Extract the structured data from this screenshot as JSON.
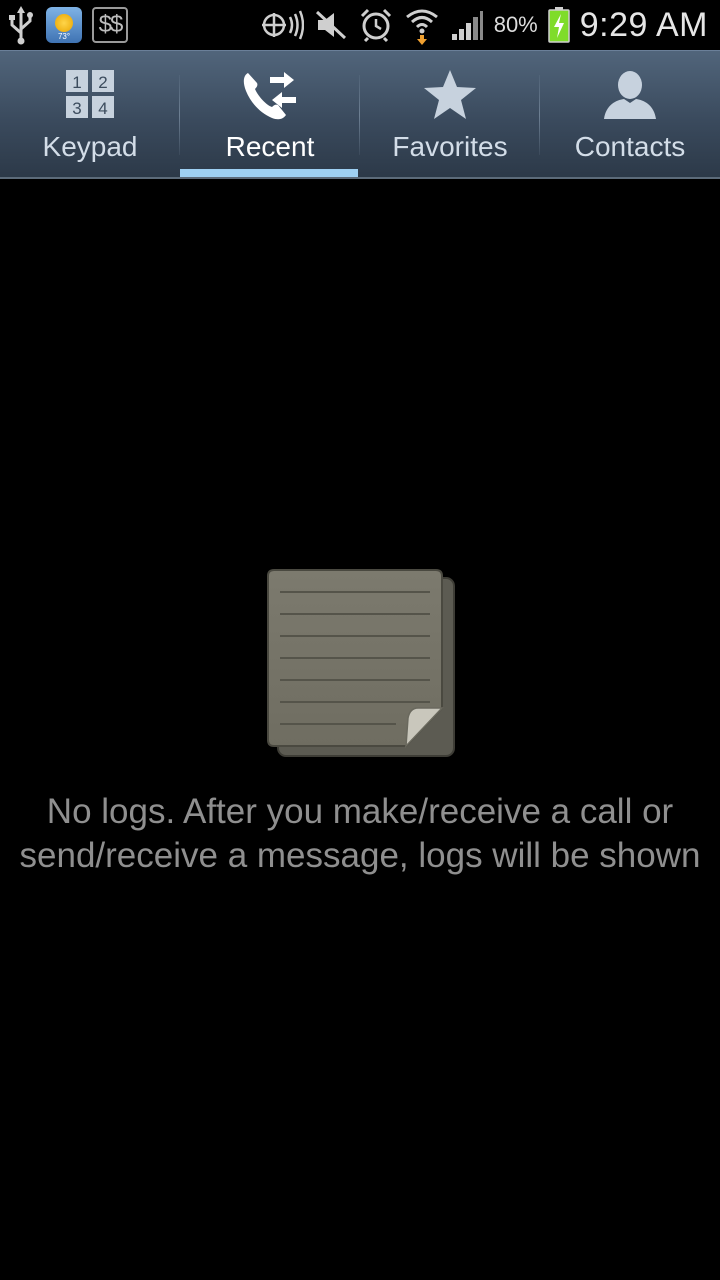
{
  "status_bar": {
    "icons_left": [
      "usb-icon",
      "weather-widget-icon",
      "dollar-app-icon"
    ],
    "weather_temp": "73°",
    "dollar_text": "$$",
    "icons_right": [
      "nfc-icon",
      "mute-icon",
      "alarm-icon",
      "wifi-icon",
      "signal-icon",
      "battery-charging-icon"
    ],
    "battery_percent": "80%",
    "time": "9:29 AM"
  },
  "tabs": [
    {
      "label": "Keypad",
      "icon": "keypad-icon",
      "active": false
    },
    {
      "label": "Recent",
      "icon": "recent-calls-icon",
      "active": true
    },
    {
      "label": "Favorites",
      "icon": "star-icon",
      "active": false
    },
    {
      "label": "Contacts",
      "icon": "contact-icon",
      "active": false
    }
  ],
  "keypad_digits": [
    "1",
    "2",
    "3",
    "4"
  ],
  "empty_state": {
    "icon": "empty-log-icon",
    "message": "No logs. After you make/receive a call or send/receive a message, logs will be shown"
  },
  "colors": {
    "tab_active_indicator": "#9ed0f2",
    "tabbar_top": "#51657b",
    "tabbar_bottom": "#2c3948",
    "battery_fill": "#7fdc2a"
  }
}
